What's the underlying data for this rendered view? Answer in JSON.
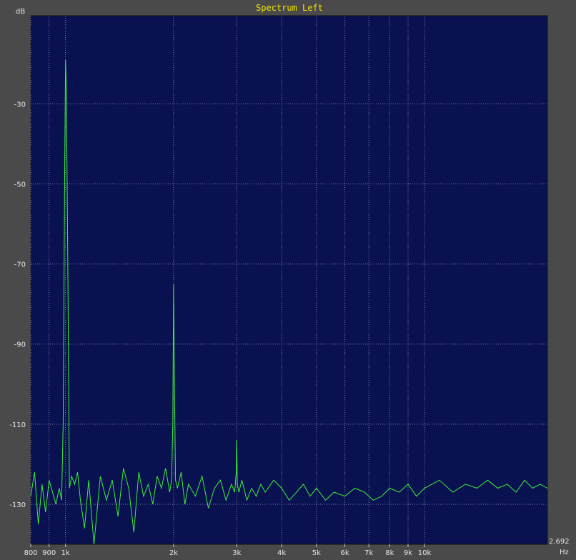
{
  "chart_data": {
    "type": "line",
    "title": "Spectrum Left",
    "ylabel": "dB",
    "xlabel": "Hz",
    "x_scale": "log",
    "xlim": [
      800,
      22000
    ],
    "ylim": [
      -140,
      -8
    ],
    "grid": true,
    "corner_readout": "2.692",
    "y_ticks": [
      {
        "value": -30,
        "label": "-30"
      },
      {
        "value": -50,
        "label": "-50"
      },
      {
        "value": -70,
        "label": "-70"
      },
      {
        "value": -90,
        "label": "-90"
      },
      {
        "value": -110,
        "label": "-110"
      },
      {
        "value": -130,
        "label": "-130"
      }
    ],
    "x_ticks": [
      {
        "value": 800,
        "label": "800"
      },
      {
        "value": 900,
        "label": "900"
      },
      {
        "value": 1000,
        "label": "1k"
      },
      {
        "value": 2000,
        "label": "2k"
      },
      {
        "value": 3000,
        "label": "3k"
      },
      {
        "value": 4000,
        "label": "4k"
      },
      {
        "value": 5000,
        "label": "5k"
      },
      {
        "value": 6000,
        "label": "6k"
      },
      {
        "value": 7000,
        "label": "7k"
      },
      {
        "value": 8000,
        "label": "8k"
      },
      {
        "value": 9000,
        "label": "9k"
      },
      {
        "value": 10000,
        "label": "10k"
      }
    ],
    "series": [
      {
        "color": "#3cf03c",
        "x": [
          800,
          820,
          840,
          860,
          880,
          900,
          920,
          940,
          960,
          975,
          985,
          995,
          1000,
          1005,
          1015,
          1025,
          1040,
          1060,
          1080,
          1100,
          1130,
          1160,
          1200,
          1250,
          1300,
          1350,
          1400,
          1450,
          1500,
          1550,
          1600,
          1650,
          1700,
          1750,
          1800,
          1850,
          1900,
          1950,
          1975,
          1990,
          2000,
          2010,
          2025,
          2050,
          2100,
          2150,
          2200,
          2300,
          2400,
          2500,
          2600,
          2700,
          2800,
          2900,
          2960,
          2990,
          3000,
          3010,
          3040,
          3100,
          3200,
          3300,
          3400,
          3500,
          3600,
          3800,
          4000,
          4200,
          4400,
          4600,
          4800,
          5000,
          5300,
          5600,
          6000,
          6400,
          6800,
          7200,
          7600,
          8000,
          8500,
          9000,
          9500,
          10000,
          11000,
          12000,
          13000,
          14000,
          15000,
          16000,
          17000,
          18000,
          19000,
          20000,
          21000,
          22000
        ],
        "y": [
          -128,
          -122,
          -135,
          -125,
          -132,
          -124,
          -127,
          -130,
          -126,
          -129,
          -110,
          -45,
          -19,
          -26,
          -70,
          -126,
          -123,
          -125,
          -122,
          -129,
          -136,
          -124,
          -141,
          -123,
          -129,
          -124,
          -133,
          -121,
          -126,
          -137,
          -122,
          -128,
          -125,
          -130,
          -123,
          -126,
          -121,
          -127,
          -124,
          -110,
          -75,
          -98,
          -124,
          -126,
          -122,
          -130,
          -125,
          -128,
          -123,
          -131,
          -126,
          -124,
          -129,
          -125,
          -127,
          -122,
          -114,
          -125,
          -127,
          -124,
          -129,
          -126,
          -128,
          -125,
          -127,
          -124,
          -126,
          -129,
          -127,
          -125,
          -128,
          -126,
          -129,
          -127,
          -128,
          -126,
          -127,
          -129,
          -128,
          -126,
          -127,
          -125,
          -128,
          -126,
          -124,
          -127,
          -125,
          -126,
          -124,
          -126,
          -125,
          -127,
          -124,
          -126,
          -125,
          -126
        ]
      }
    ]
  }
}
